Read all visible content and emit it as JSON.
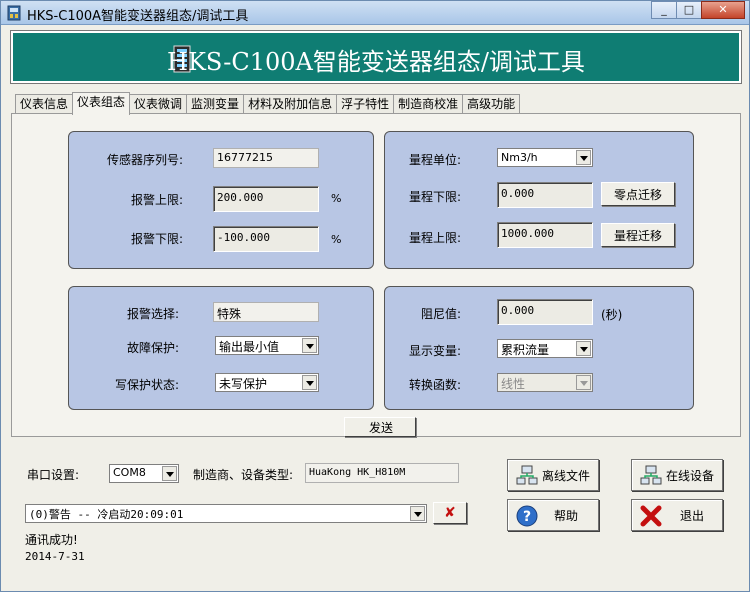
{
  "window": {
    "title": "HKS-C100A智能变送器组态/调试工具",
    "min": "_",
    "max": "□",
    "close": "✕"
  },
  "banner": {
    "title": "HKS-C100A智能变送器组态/调试工具"
  },
  "tabs": [
    "仪表信息",
    "仪表组态",
    "仪表微调",
    "监测变量",
    "材料及附加信息",
    "浮子特性",
    "制造商校准",
    "高级功能"
  ],
  "group1": {
    "serial_label": "传感器序列号:",
    "serial_value": "16777215",
    "alarm_high_label": "报警上限:",
    "alarm_high_value": "200.000",
    "alarm_high_unit": "%",
    "alarm_low_label": "报警下限:",
    "alarm_low_value": "-100.000",
    "alarm_low_unit": "%"
  },
  "group2": {
    "range_unit_label": "量程单位:",
    "range_unit_value": "Nm3/h",
    "range_low_label": "量程下限:",
    "range_low_value": "0.000",
    "zero_shift_button": "零点迁移",
    "range_high_label": "量程上限:",
    "range_high_value": "1000.000",
    "range_shift_button": "量程迁移"
  },
  "group3": {
    "alarm_select_label": "报警选择:",
    "alarm_select_value": "特殊",
    "fault_protect_label": "故障保护:",
    "fault_protect_value": "输出最小值",
    "write_protect_label": "写保护状态:",
    "write_protect_value": "未写保护"
  },
  "group4": {
    "damping_label": "阻尼值:",
    "damping_value": "0.000",
    "damping_unit": "(秒)",
    "display_var_label": "显示变量:",
    "display_var_value": "累积流量",
    "transfer_label": "转换函数:",
    "transfer_value": "线性"
  },
  "send_button": "发送",
  "bottom": {
    "port_label": "串口设置:",
    "port_value": "COM8",
    "vendor_label": "制造商、设备类型:",
    "vendor_value": "HuaKong HK_H810M",
    "log_value": "(0)警告 -- 冷启动20:09:01",
    "clear_button": "✘",
    "status": "通讯成功!",
    "date": "2014-7-31",
    "offline_button": "离线文件",
    "online_button": "在线设备",
    "help_button": "帮助",
    "exit_button": "退出"
  },
  "colors": {
    "banner": "#0f7d73",
    "group": "#b8c6e4"
  }
}
